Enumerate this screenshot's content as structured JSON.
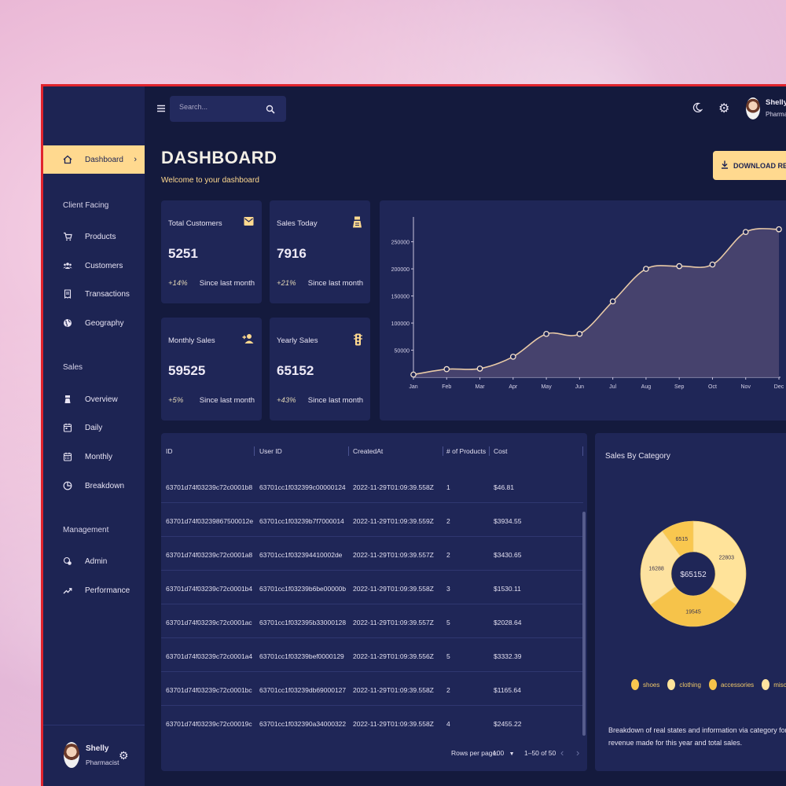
{
  "app": {
    "title": "DASHBOARD",
    "subtitle": "Welcome to your dashboard"
  },
  "search": {
    "placeholder": "Search..."
  },
  "user": {
    "name": "Shelly",
    "role": "Pharmacist",
    "role_truncated": "Pharmaci"
  },
  "download_label": "DOWNLOAD REPOR",
  "sidebar": {
    "dashboard": "Dashboard",
    "sections": {
      "client": "Client Facing",
      "sales": "Sales",
      "management": "Management"
    },
    "items": {
      "products": "Products",
      "customers": "Customers",
      "transactions": "Transactions",
      "geography": "Geography",
      "overview": "Overview",
      "daily": "Daily",
      "monthly": "Monthly",
      "breakdown": "Breakdown",
      "admin": "Admin",
      "performance": "Performance"
    }
  },
  "stats": {
    "total_customers": {
      "title": "Total Customers",
      "value": "5251",
      "change": "+14%",
      "since": "Since last month"
    },
    "sales_today": {
      "title": "Sales Today",
      "value": "7916",
      "change": "+21%",
      "since": "Since last month"
    },
    "monthly_sales": {
      "title": "Monthly Sales",
      "value": "59525",
      "change": "+5%",
      "since": "Since last month"
    },
    "yearly_sales": {
      "title": "Yearly Sales",
      "value": "65152",
      "change": "+43%",
      "since": "Since last month"
    }
  },
  "chart_data": {
    "type": "area",
    "x": [
      "Jan",
      "Feb",
      "Mar",
      "Apr",
      "May",
      "Jun",
      "Jul",
      "Aug",
      "Sep",
      "Oct",
      "Nov",
      "Dec"
    ],
    "values": [
      5000,
      15000,
      16000,
      38000,
      80000,
      80000,
      140000,
      200000,
      205000,
      208000,
      268000,
      273000
    ],
    "yticks": [
      "250000",
      "200000",
      "150000",
      "100000",
      "50000"
    ],
    "ytick_values": [
      250000,
      200000,
      150000,
      100000,
      50000
    ],
    "ylim": [
      0,
      290000
    ],
    "grid": false,
    "colors": {
      "line": "#e8c9a6",
      "fill": "#4a4670",
      "marker": "#f6e3cf"
    }
  },
  "table": {
    "headers": {
      "id": "ID",
      "user_id": "User ID",
      "created": "CreatedAt",
      "products": "# of Products",
      "cost": "Cost"
    },
    "rows": [
      {
        "id": "63701d74f03239c72c0001b8",
        "user_id": "63701cc1f032399c00000124",
        "created": "2022-11-29T01:09:39.558Z",
        "products": "1",
        "cost": "$46.81"
      },
      {
        "id": "63701d74f03239867500012e",
        "user_id": "63701cc1f03239b7f7000014",
        "created": "2022-11-29T01:09:39.559Z",
        "products": "2",
        "cost": "$3934.55"
      },
      {
        "id": "63701d74f03239c72c0001a8",
        "user_id": "63701cc1f032394410002de",
        "created": "2022-11-29T01:09:39.557Z",
        "products": "2",
        "cost": "$3430.65"
      },
      {
        "id": "63701d74f03239c72c0001b4",
        "user_id": "63701cc1f03239b6be00000b",
        "created": "2022-11-29T01:09:39.558Z",
        "products": "3",
        "cost": "$1530.11"
      },
      {
        "id": "63701d74f03239c72c0001ac",
        "user_id": "63701cc1f032395b33000128",
        "created": "2022-11-29T01:09:39.557Z",
        "products": "5",
        "cost": "$2028.64"
      },
      {
        "id": "63701d74f03239c72c0001a4",
        "user_id": "63701cc1f03239bef0000129",
        "created": "2022-11-29T01:09:39.556Z",
        "products": "5",
        "cost": "$3332.39"
      },
      {
        "id": "63701d74f03239c72c0001bc",
        "user_id": "63701cc1f03239db69000127",
        "created": "2022-11-29T01:09:39.558Z",
        "products": "2",
        "cost": "$1165.64"
      },
      {
        "id": "63701d74f03239c72c00019c",
        "user_id": "63701cc1f032390a34000322",
        "created": "2022-11-29T01:09:39.558Z",
        "products": "4",
        "cost": "$2455.22"
      }
    ],
    "footer": {
      "rows_per_page_label": "Rows per page:",
      "rows_per_page": "100",
      "range": "1–50 of 50"
    }
  },
  "category": {
    "title": "Sales By Category",
    "total": "$65152",
    "slices": [
      {
        "name": "shoes",
        "value": 6515,
        "label": "6515",
        "color": "#f9c74f"
      },
      {
        "name": "clothing",
        "value": 22803,
        "label": "22803",
        "color": "#ffe39a"
      },
      {
        "name": "accessories",
        "value": 19545,
        "label": "19545",
        "color": "#f6c34a"
      },
      {
        "name": "misc",
        "value": 16288,
        "label": "16288",
        "color": "#fde2a0"
      }
    ],
    "legend": [
      "shoes",
      "clothing",
      "accessories",
      "misc"
    ],
    "description": "Breakdown of real states and information via category for revenue made for this year and total sales."
  }
}
